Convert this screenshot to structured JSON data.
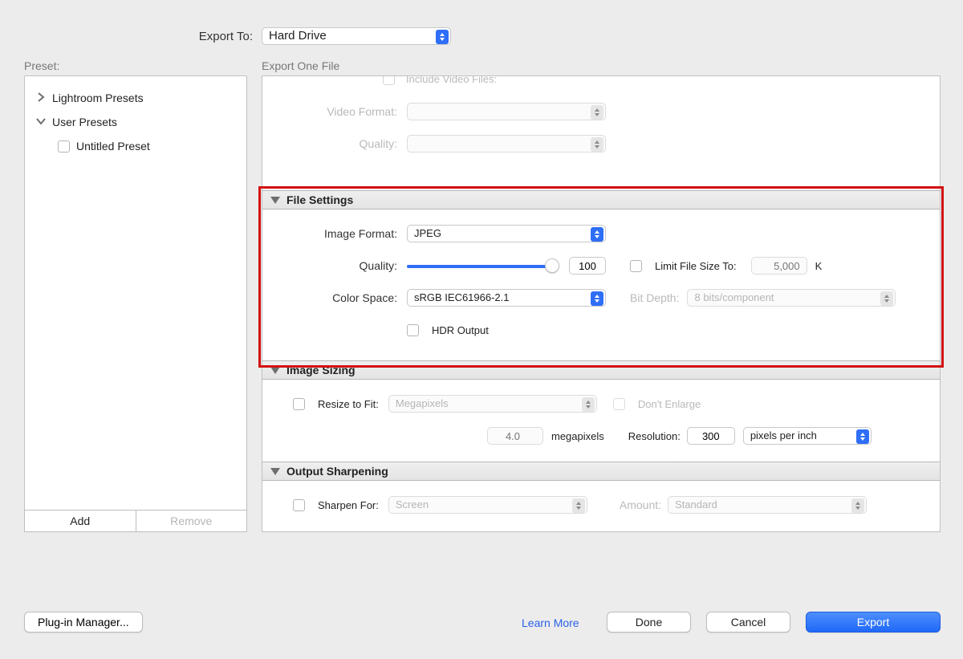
{
  "header": {
    "export_to_label": "Export To:",
    "export_to_value": "Hard Drive",
    "preset_header": "Preset:",
    "export_count": "Export One File"
  },
  "presets": {
    "group1": "Lightroom Presets",
    "group2": "User Presets",
    "item": "Untitled Preset",
    "add": "Add",
    "remove": "Remove"
  },
  "video": {
    "include": "Include Video Files:",
    "format_label": "Video Format:",
    "quality_label": "Quality:"
  },
  "file_settings": {
    "title": "File Settings",
    "image_format_label": "Image Format:",
    "image_format_value": "JPEG",
    "quality_label": "Quality:",
    "quality_value": "100",
    "limit_label": "Limit File Size To:",
    "limit_value": "5,000",
    "limit_unit": "K",
    "color_space_label": "Color Space:",
    "color_space_value": "sRGB IEC61966-2.1",
    "bit_depth_label": "Bit Depth:",
    "bit_depth_value": "8 bits/component",
    "hdr_label": "HDR Output"
  },
  "image_sizing": {
    "title": "Image Sizing",
    "resize_label": "Resize to Fit:",
    "resize_mode": "Megapixels",
    "dont_enlarge": "Don't Enlarge",
    "mp_value": "4.0",
    "mp_unit": "megapixels",
    "resolution_label": "Resolution:",
    "resolution_value": "300",
    "resolution_unit": "pixels per inch"
  },
  "sharpen": {
    "title": "Output Sharpening",
    "sharpen_for_label": "Sharpen For:",
    "sharpen_for_value": "Screen",
    "amount_label": "Amount:",
    "amount_value": "Standard"
  },
  "footer": {
    "plugin": "Plug-in Manager...",
    "learn": "Learn More",
    "done": "Done",
    "cancel": "Cancel",
    "export": "Export"
  }
}
